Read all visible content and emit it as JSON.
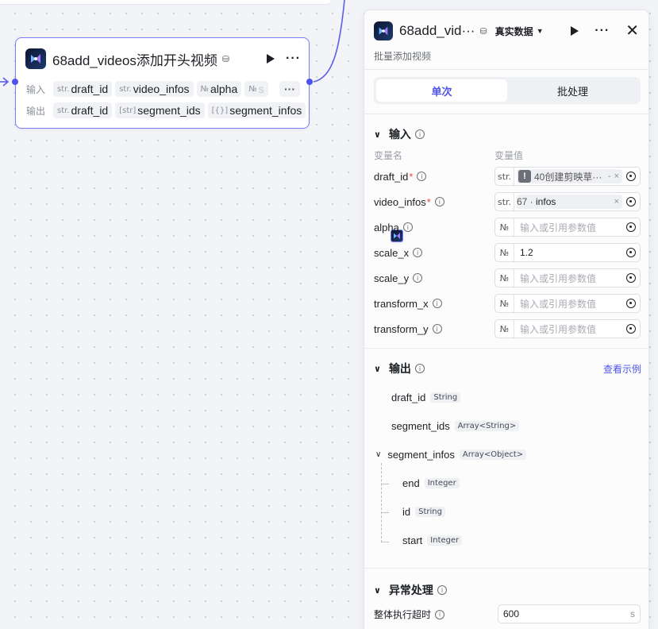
{
  "node": {
    "title": "68add_videos添加开头视频",
    "input_label": "输入",
    "output_label": "输出",
    "inputs": [
      {
        "type": "str.",
        "name": "draft_id"
      },
      {
        "type": "str.",
        "name": "video_infos"
      },
      {
        "type": "№",
        "name": "alpha"
      },
      {
        "type": "№",
        "name": "s"
      }
    ],
    "outputs": [
      {
        "type": "str.",
        "name": "draft_id"
      },
      {
        "type": "[str]",
        "name": "segment_ids"
      },
      {
        "type": "[{}]",
        "name": "segment_infos"
      }
    ],
    "more": "···"
  },
  "panel": {
    "title": "68add_vid···",
    "data_mode": "真实数据",
    "description": "批量添加视频",
    "tabs": [
      "单次",
      "批处理"
    ],
    "input_section": "输入",
    "col_name": "变量名",
    "col_value": "变量值",
    "params": [
      {
        "name": "draft_id",
        "required": true,
        "type": "str.",
        "ref": {
          "icon": "warning-icon",
          "text": "40创建剪映草···",
          "extra": "-"
        }
      },
      {
        "name": "video_infos",
        "required": true,
        "type": "str.",
        "ref": {
          "icon": "node-icon",
          "text": "67 · ",
          "field": "infos"
        }
      },
      {
        "name": "alpha",
        "required": false,
        "type": "№",
        "placeholder": "输入或引用参数值"
      },
      {
        "name": "scale_x",
        "required": false,
        "type": "№",
        "value": "1.2"
      },
      {
        "name": "scale_y",
        "required": false,
        "type": "№",
        "placeholder": "输入或引用参数值"
      },
      {
        "name": "transform_x",
        "required": false,
        "type": "№",
        "placeholder": "输入或引用参数值"
      },
      {
        "name": "transform_y",
        "required": false,
        "type": "№",
        "placeholder": "输入或引用参数值"
      }
    ],
    "output_section": "输出",
    "view_example": "查看示例",
    "outputs": [
      {
        "name": "draft_id",
        "type": "String"
      },
      {
        "name": "segment_ids",
        "type": "Array<String>"
      },
      {
        "name": "segment_infos",
        "type": "Array<Object>",
        "children": [
          {
            "name": "end",
            "type": "Integer"
          },
          {
            "name": "id",
            "type": "String"
          },
          {
            "name": "start",
            "type": "Integer"
          }
        ]
      }
    ],
    "error_section": "异常处理",
    "timeout_label": "整体执行超时",
    "timeout_value": "600",
    "timeout_unit": "s"
  },
  "colors": {
    "accent": "#4d53e8",
    "required": "#e5484d"
  }
}
